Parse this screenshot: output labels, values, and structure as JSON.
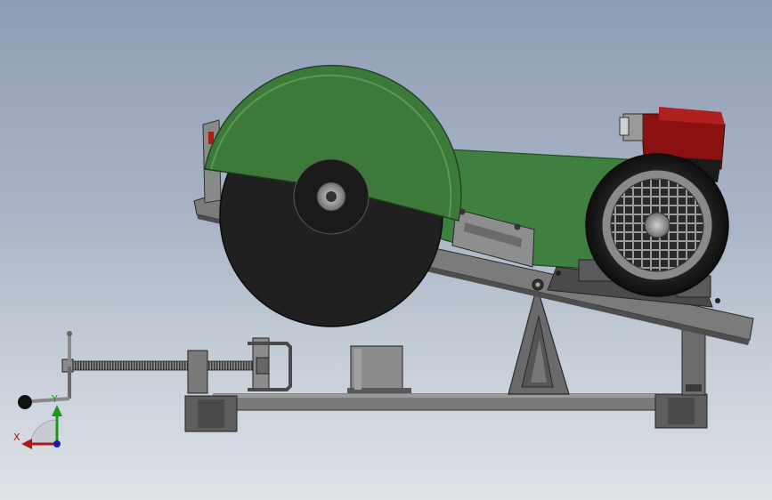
{
  "viewport": {
    "background_top": "#8f9db4",
    "background_bottom": "#dfe3e8"
  },
  "model": {
    "guard_color": "#3d7a3a",
    "blade_color": "#202020",
    "motor_cover_color": "#8b1010",
    "frame_color": "#6e6e6e",
    "arm_color": "#3f8040"
  },
  "triad": {
    "x_label": "X",
    "y_label": "Y",
    "x_color": "#b01818",
    "y_color": "#1a9a1a",
    "z_color": "#1a1ab0"
  }
}
